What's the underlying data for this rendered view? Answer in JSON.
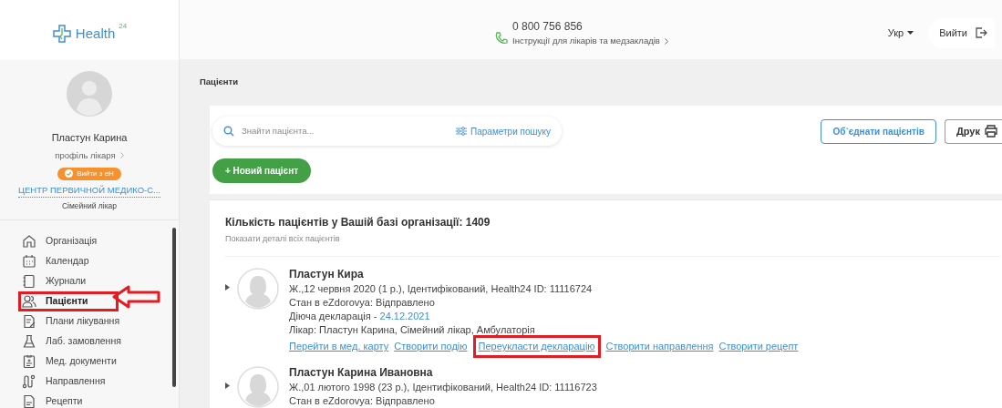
{
  "header": {
    "logo": "Health",
    "logo_sup": "24",
    "phone": "0 800 756 856",
    "instructions": "Інструкції для лікарів та медзакладів",
    "language": "Укр",
    "logout": "Вийти"
  },
  "profile": {
    "name": "Пластун Карина",
    "profile_link": "профіль лікаря",
    "ehealth_button": "Вийти з еН",
    "organization": "ЦЕНТР ПЕРВИЧНОЙ МЕДИКО-С...",
    "role": "Сімейний лікар"
  },
  "nav": [
    {
      "label": "Організація",
      "selected": false,
      "highlighted": false
    },
    {
      "label": "Календар",
      "selected": false,
      "highlighted": false
    },
    {
      "label": "Журнали",
      "selected": false,
      "highlighted": false
    },
    {
      "label": "Пацієнти",
      "selected": true,
      "highlighted": true
    },
    {
      "label": "Плани лікування",
      "selected": false,
      "highlighted": false
    },
    {
      "label": "Лаб. замовлення",
      "selected": false,
      "highlighted": false
    },
    {
      "label": "Мед. документи",
      "selected": false,
      "highlighted": false
    },
    {
      "label": "Направлення",
      "selected": false,
      "highlighted": false
    },
    {
      "label": "Рецепти",
      "selected": false,
      "highlighted": false
    }
  ],
  "page_title": "Пацієнти",
  "toolbar": {
    "search_placeholder": "Знайти пацієнта...",
    "search_params": "Параметри пошуку",
    "merge_button": "Об`єднати пацієнтів",
    "print_button": "Друк",
    "new_patient_button": "+ Новий пацієнт"
  },
  "summary": {
    "title": "Кількість пацієнтів у Вашій базі організації: 1409",
    "details_link": "Показати деталі всіх пацієнтів"
  },
  "patients": [
    {
      "name": "Пластун Кира",
      "info": "Ж.,12 червня 2020 (1 р.),  Ідентифікований, Health24 ID: 11116724",
      "status": "Стан в eZdorovya: Відправлено",
      "declaration_label": "Діюча декларація - ",
      "declaration_date": "24.12.2021",
      "doctor": "Лікар: Пластун Карина, Сімейний лікар, Амбулаторія",
      "actions": [
        {
          "label": "Перейти в мед. карту",
          "highlighted": false
        },
        {
          "label": "Створити подію",
          "highlighted": false
        },
        {
          "label": "Переукласти декларацію",
          "highlighted": true
        },
        {
          "label": "Створити направлення",
          "highlighted": false
        },
        {
          "label": "Створити рецепт",
          "highlighted": false
        }
      ]
    },
    {
      "name": "Пластун Карина Ивановна",
      "info": "Ж.,01 лютого 1998 (23 р.),  Ідентифікований, Health24 ID: 11116723",
      "status": "Стан в eZdorovya: Відправлено"
    }
  ]
}
